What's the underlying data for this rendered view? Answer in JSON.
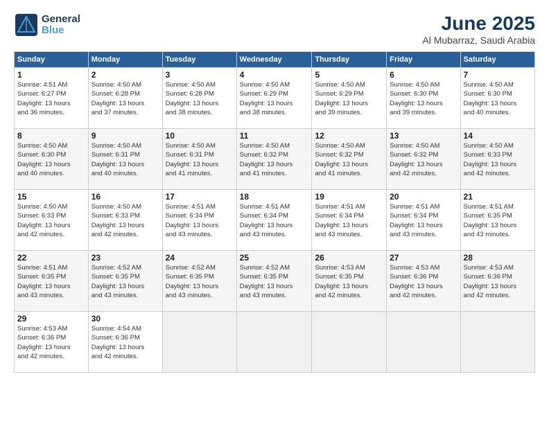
{
  "header": {
    "logo_line1": "General",
    "logo_line2": "Blue",
    "month_year": "June 2025",
    "location": "Al Mubarraz, Saudi Arabia"
  },
  "weekdays": [
    "Sunday",
    "Monday",
    "Tuesday",
    "Wednesday",
    "Thursday",
    "Friday",
    "Saturday"
  ],
  "weeks": [
    [
      {
        "day": "1",
        "info": "Sunrise: 4:51 AM\nSunset: 6:27 PM\nDaylight: 13 hours\nand 36 minutes."
      },
      {
        "day": "2",
        "info": "Sunrise: 4:50 AM\nSunset: 6:28 PM\nDaylight: 13 hours\nand 37 minutes."
      },
      {
        "day": "3",
        "info": "Sunrise: 4:50 AM\nSunset: 6:28 PM\nDaylight: 13 hours\nand 38 minutes."
      },
      {
        "day": "4",
        "info": "Sunrise: 4:50 AM\nSunset: 6:29 PM\nDaylight: 13 hours\nand 38 minutes."
      },
      {
        "day": "5",
        "info": "Sunrise: 4:50 AM\nSunset: 6:29 PM\nDaylight: 13 hours\nand 39 minutes."
      },
      {
        "day": "6",
        "info": "Sunrise: 4:50 AM\nSunset: 6:30 PM\nDaylight: 13 hours\nand 39 minutes."
      },
      {
        "day": "7",
        "info": "Sunrise: 4:50 AM\nSunset: 6:30 PM\nDaylight: 13 hours\nand 40 minutes."
      }
    ],
    [
      {
        "day": "8",
        "info": "Sunrise: 4:50 AM\nSunset: 6:30 PM\nDaylight: 13 hours\nand 40 minutes."
      },
      {
        "day": "9",
        "info": "Sunrise: 4:50 AM\nSunset: 6:31 PM\nDaylight: 13 hours\nand 40 minutes."
      },
      {
        "day": "10",
        "info": "Sunrise: 4:50 AM\nSunset: 6:31 PM\nDaylight: 13 hours\nand 41 minutes."
      },
      {
        "day": "11",
        "info": "Sunrise: 4:50 AM\nSunset: 6:32 PM\nDaylight: 13 hours\nand 41 minutes."
      },
      {
        "day": "12",
        "info": "Sunrise: 4:50 AM\nSunset: 6:32 PM\nDaylight: 13 hours\nand 41 minutes."
      },
      {
        "day": "13",
        "info": "Sunrise: 4:50 AM\nSunset: 6:32 PM\nDaylight: 13 hours\nand 42 minutes."
      },
      {
        "day": "14",
        "info": "Sunrise: 4:50 AM\nSunset: 6:33 PM\nDaylight: 13 hours\nand 42 minutes."
      }
    ],
    [
      {
        "day": "15",
        "info": "Sunrise: 4:50 AM\nSunset: 6:33 PM\nDaylight: 13 hours\nand 42 minutes."
      },
      {
        "day": "16",
        "info": "Sunrise: 4:50 AM\nSunset: 6:33 PM\nDaylight: 13 hours\nand 42 minutes."
      },
      {
        "day": "17",
        "info": "Sunrise: 4:51 AM\nSunset: 6:34 PM\nDaylight: 13 hours\nand 43 minutes."
      },
      {
        "day": "18",
        "info": "Sunrise: 4:51 AM\nSunset: 6:34 PM\nDaylight: 13 hours\nand 43 minutes."
      },
      {
        "day": "19",
        "info": "Sunrise: 4:51 AM\nSunset: 6:34 PM\nDaylight: 13 hours\nand 43 minutes."
      },
      {
        "day": "20",
        "info": "Sunrise: 4:51 AM\nSunset: 6:34 PM\nDaylight: 13 hours\nand 43 minutes."
      },
      {
        "day": "21",
        "info": "Sunrise: 4:51 AM\nSunset: 6:35 PM\nDaylight: 13 hours\nand 43 minutes."
      }
    ],
    [
      {
        "day": "22",
        "info": "Sunrise: 4:51 AM\nSunset: 6:35 PM\nDaylight: 13 hours\nand 43 minutes."
      },
      {
        "day": "23",
        "info": "Sunrise: 4:52 AM\nSunset: 6:35 PM\nDaylight: 13 hours\nand 43 minutes."
      },
      {
        "day": "24",
        "info": "Sunrise: 4:52 AM\nSunset: 6:35 PM\nDaylight: 13 hours\nand 43 minutes."
      },
      {
        "day": "25",
        "info": "Sunrise: 4:52 AM\nSunset: 6:35 PM\nDaylight: 13 hours\nand 43 minutes."
      },
      {
        "day": "26",
        "info": "Sunrise: 4:53 AM\nSunset: 6:35 PM\nDaylight: 13 hours\nand 42 minutes."
      },
      {
        "day": "27",
        "info": "Sunrise: 4:53 AM\nSunset: 6:36 PM\nDaylight: 13 hours\nand 42 minutes."
      },
      {
        "day": "28",
        "info": "Sunrise: 4:53 AM\nSunset: 6:36 PM\nDaylight: 13 hours\nand 42 minutes."
      }
    ],
    [
      {
        "day": "29",
        "info": "Sunrise: 4:53 AM\nSunset: 6:36 PM\nDaylight: 13 hours\nand 42 minutes."
      },
      {
        "day": "30",
        "info": "Sunrise: 4:54 AM\nSunset: 6:36 PM\nDaylight: 13 hours\nand 42 minutes."
      },
      null,
      null,
      null,
      null,
      null
    ]
  ]
}
